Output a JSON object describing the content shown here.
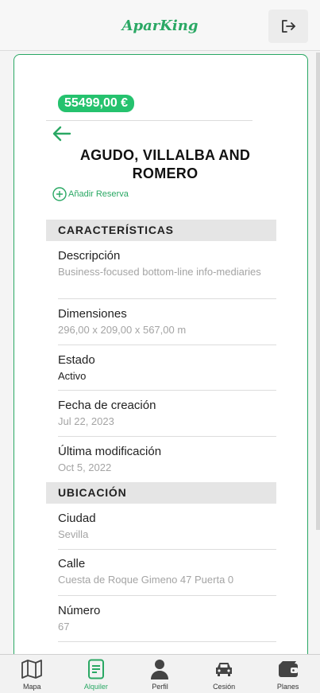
{
  "header": {
    "logo": "AparKing"
  },
  "listing": {
    "price": "55499,00 €",
    "title": "AGUDO, VILLALBA AND ROMERO",
    "add_reservation": "Añadir Reserva"
  },
  "sections": {
    "characteristics": "CARACTERÍSTICAS",
    "location": "UBICACIÓN"
  },
  "fields": {
    "descripcion": {
      "label": "Descripción",
      "value": "Business-focused bottom-line info-mediaries"
    },
    "dimensiones": {
      "label": "Dimensiones",
      "value": "296,00 x 209,00 x 567,00 m"
    },
    "estado": {
      "label": "Estado",
      "value": "Activo"
    },
    "fecha_creacion": {
      "label": "Fecha de creación",
      "value": "Jul 22, 2023"
    },
    "ultima_modificacion": {
      "label": "Última modificación",
      "value": "Oct 5, 2022"
    },
    "ciudad": {
      "label": "Ciudad",
      "value": "Sevilla"
    },
    "calle": {
      "label": "Calle",
      "value": "Cuesta de Roque Gimeno 47 Puerta 0"
    },
    "numero": {
      "label": "Número",
      "value": "67"
    }
  },
  "nav": {
    "items": [
      {
        "label": "Mapa",
        "icon": "map-icon",
        "active": false
      },
      {
        "label": "Alquiler",
        "icon": "document-icon",
        "active": true
      },
      {
        "label": "Perfil",
        "icon": "user-icon",
        "active": false
      },
      {
        "label": "Cesión",
        "icon": "car-icon",
        "active": false
      },
      {
        "label": "Planes",
        "icon": "wallet-icon",
        "active": false
      }
    ]
  },
  "colors": {
    "accent": "#2aa864",
    "price_badge": "#25c26e"
  }
}
